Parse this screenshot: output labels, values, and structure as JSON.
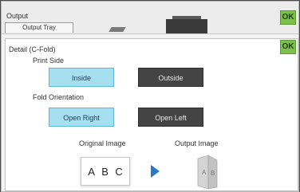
{
  "output": {
    "title": "Output",
    "tray_tab": "Output Tray",
    "ok_label": "OK"
  },
  "detail": {
    "title": "Detail (C-Fold)",
    "ok_label": "OK",
    "print_side": {
      "label": "Print Side",
      "options": [
        "Inside",
        "Outside"
      ],
      "selected": "Inside"
    },
    "fold_orientation": {
      "label": "Fold Orientation",
      "options": [
        "Open Right",
        "Open Left"
      ],
      "selected": "Open Right"
    },
    "original_image_label": "Original Image",
    "output_image_label": "Output Image",
    "original_letters": [
      "A",
      "B",
      "C"
    ],
    "output_letters": [
      "A",
      "B"
    ]
  },
  "colors": {
    "ok": "#7cc04a",
    "selected": "#a6dff0",
    "unselected": "#444444",
    "arrow": "#2a78c8"
  },
  "icons": [
    "machine-icon",
    "arrow-right-icon",
    "folded-paper-icon"
  ]
}
